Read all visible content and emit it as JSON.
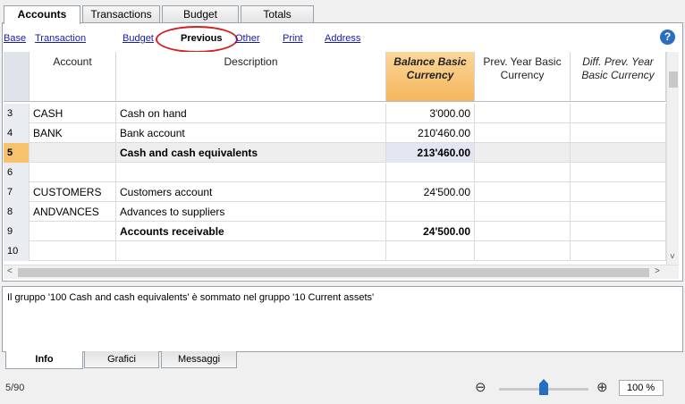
{
  "tabs": [
    "Accounts",
    "Transactions",
    "Budget",
    "Totals"
  ],
  "views": [
    "Base",
    "Transaction",
    "Budget",
    "Previous",
    "Other",
    "Print",
    "Address"
  ],
  "help_symbol": "?",
  "columns": {
    "account": "Account",
    "description": "Description",
    "balance": [
      "Balance Basic",
      "Currency"
    ],
    "prev": [
      "Prev. Year Basic",
      "Currency"
    ],
    "diff": [
      "Diff. Prev. Year",
      "Basic Currency"
    ]
  },
  "rows": [
    {
      "num": "3",
      "account": "CASH",
      "description": "Cash on hand",
      "balance": "3'000.00"
    },
    {
      "num": "4",
      "account": "BANK",
      "description": "Bank account",
      "balance": "210'460.00"
    },
    {
      "num": "5",
      "account": "",
      "description": "Cash and cash equivalents",
      "balance": "213'460.00"
    },
    {
      "num": "6",
      "account": "",
      "description": "",
      "balance": ""
    },
    {
      "num": "7",
      "account": "CUSTOMERS",
      "description": "Customers account",
      "balance": "24'500.00"
    },
    {
      "num": "8",
      "account": "ANDVANCES",
      "description": "Advances to suppliers",
      "balance": ""
    },
    {
      "num": "9",
      "account": "",
      "description": "Accounts receivable",
      "balance": "24'500.00"
    },
    {
      "num": "10",
      "account": "",
      "description": "",
      "balance": ""
    }
  ],
  "info_message": "Il gruppo '100 Cash and cash equivalents' è sommato nel gruppo '10 Current assets'",
  "bottom_tabs": [
    "Info",
    "Grafici",
    "Messaggi"
  ],
  "status_position": "5/90",
  "zoom_value": "100 %",
  "accent_color": "#f5b55c",
  "highlight_color": "#d62020"
}
